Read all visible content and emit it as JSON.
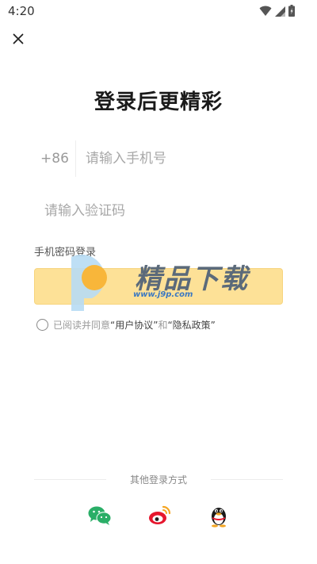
{
  "status_bar": {
    "time": "4:20",
    "icons": [
      "wifi-icon",
      "signal-icon",
      "battery-icon"
    ]
  },
  "close_icon": "close-icon",
  "title": "登录后更精彩",
  "phone": {
    "country_code": "+86",
    "placeholder": "请输入手机号",
    "value": ""
  },
  "code": {
    "placeholder": "请输入验证码",
    "value": ""
  },
  "password_login_link": "手机密码登录",
  "login_button_label": "",
  "watermark": {
    "text": "精品下载",
    "url": "www.j9p.com"
  },
  "agreement": {
    "checked": false,
    "prefix": "已阅读并同意",
    "user_agreement": "“用户协议”",
    "and": "和",
    "privacy_policy": "“隐私政策”"
  },
  "other_login": {
    "label": "其他登录方式",
    "methods": [
      "wechat-icon",
      "weibo-icon",
      "qq-icon"
    ]
  },
  "colors": {
    "button_bg": "#fde197",
    "wechat": "#2aae67",
    "weibo": "#e6162d",
    "weibo_orange": "#f5a623"
  }
}
